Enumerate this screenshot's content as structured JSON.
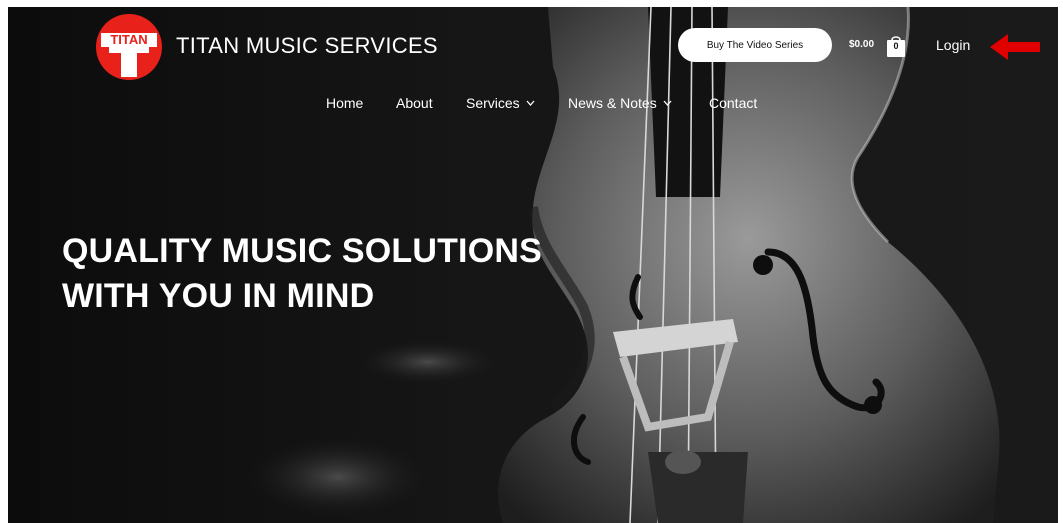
{
  "header": {
    "logo_text": "TITAN",
    "site_title": "TITAN MUSIC SERVICES",
    "cta_label": "Buy The Video Series",
    "cart_total": "$0.00",
    "cart_count": "0",
    "login_label": "Login"
  },
  "nav": {
    "items": [
      {
        "label": "Home"
      },
      {
        "label": "About"
      },
      {
        "label": "Services"
      },
      {
        "label": "News & Notes"
      },
      {
        "label": "Contact"
      }
    ]
  },
  "hero": {
    "headline_line1": "QUALITY MUSIC SOLUTIONS",
    "headline_line2": "WITH YOU IN MIND"
  },
  "colors": {
    "brand_red": "#e8211b",
    "background": "#101010",
    "text": "#ffffff",
    "arrow": "#e00000"
  },
  "icons": [
    "logo",
    "cart-icon",
    "chevron-down-icon",
    "red-arrow-icon"
  ]
}
